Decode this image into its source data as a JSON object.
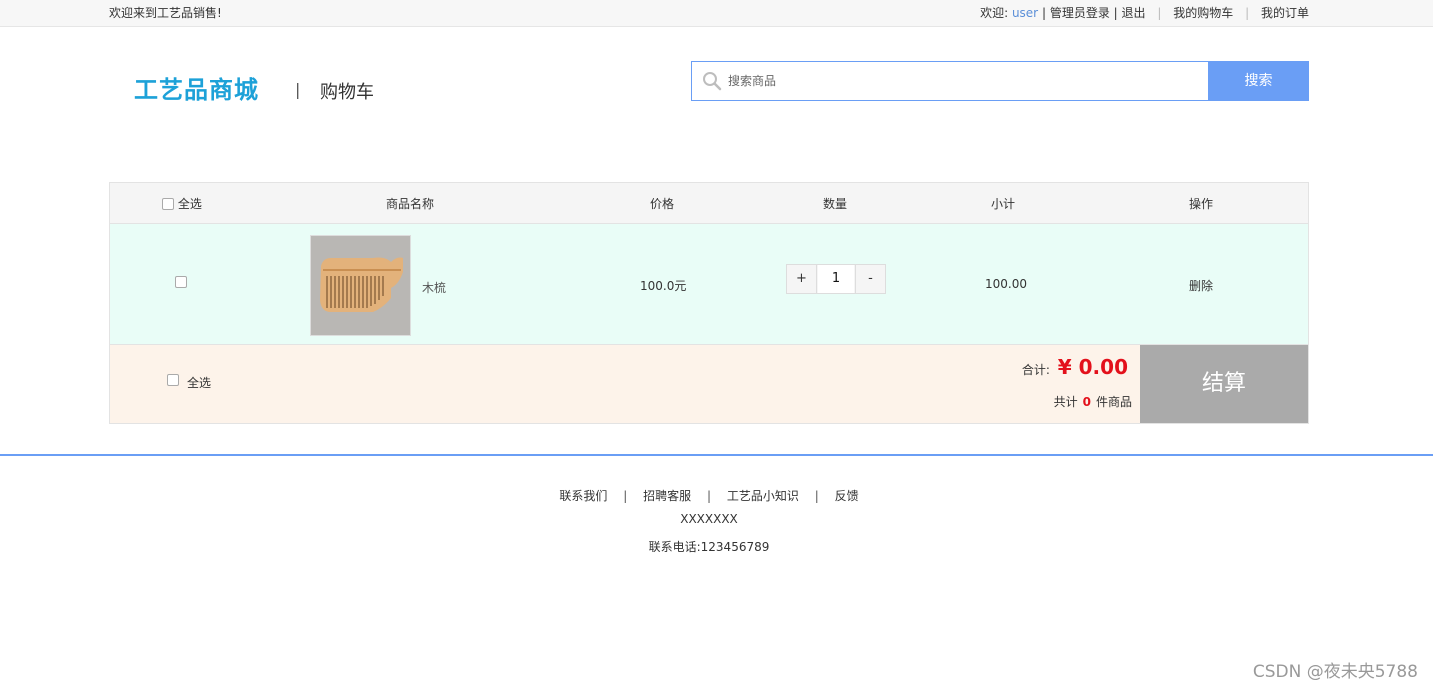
{
  "topbar": {
    "welcome": "欢迎来到工艺品销售!",
    "greeting": "欢迎:",
    "username": "user",
    "admin_login": "管理员登录",
    "logout": "退出",
    "my_cart": "我的购物车",
    "my_orders": "我的订单"
  },
  "header": {
    "logo": "工艺品商城",
    "divider": "|",
    "page_label": "购物车"
  },
  "search": {
    "placeholder": "搜索商品",
    "button": "搜索"
  },
  "cart": {
    "columns": {
      "select_all": "全选",
      "name": "商品名称",
      "price": "价格",
      "quantity": "数量",
      "subtotal": "小计",
      "action": "操作"
    },
    "items": [
      {
        "name": "木梳",
        "price": "100.0元",
        "plus": "+",
        "quantity": "1",
        "minus": "-",
        "subtotal": "100.00",
        "action": "删除"
      }
    ],
    "footer": {
      "select_all": "全选",
      "total_label": "合计:",
      "total_value": "¥ 0.00",
      "count_prefix": "共计",
      "count_value": "0",
      "count_suffix": "件商品",
      "checkout": "结算"
    }
  },
  "footer": {
    "links": [
      "联系我们",
      "招聘客服",
      "工艺品小知识",
      "反馈"
    ],
    "separator": "|",
    "address": "XXXXXXX",
    "phone": "联系电话:123456789"
  },
  "watermark": "CSDN @夜未央5788",
  "colors": {
    "accent_blue": "#6a9ef5",
    "logo_blue": "#1da1d8",
    "price_red": "#e3101b",
    "row_bg": "#e9fdf7",
    "footer_bg": "#fdf3ea",
    "checkout_bg": "#aaaaaa"
  }
}
